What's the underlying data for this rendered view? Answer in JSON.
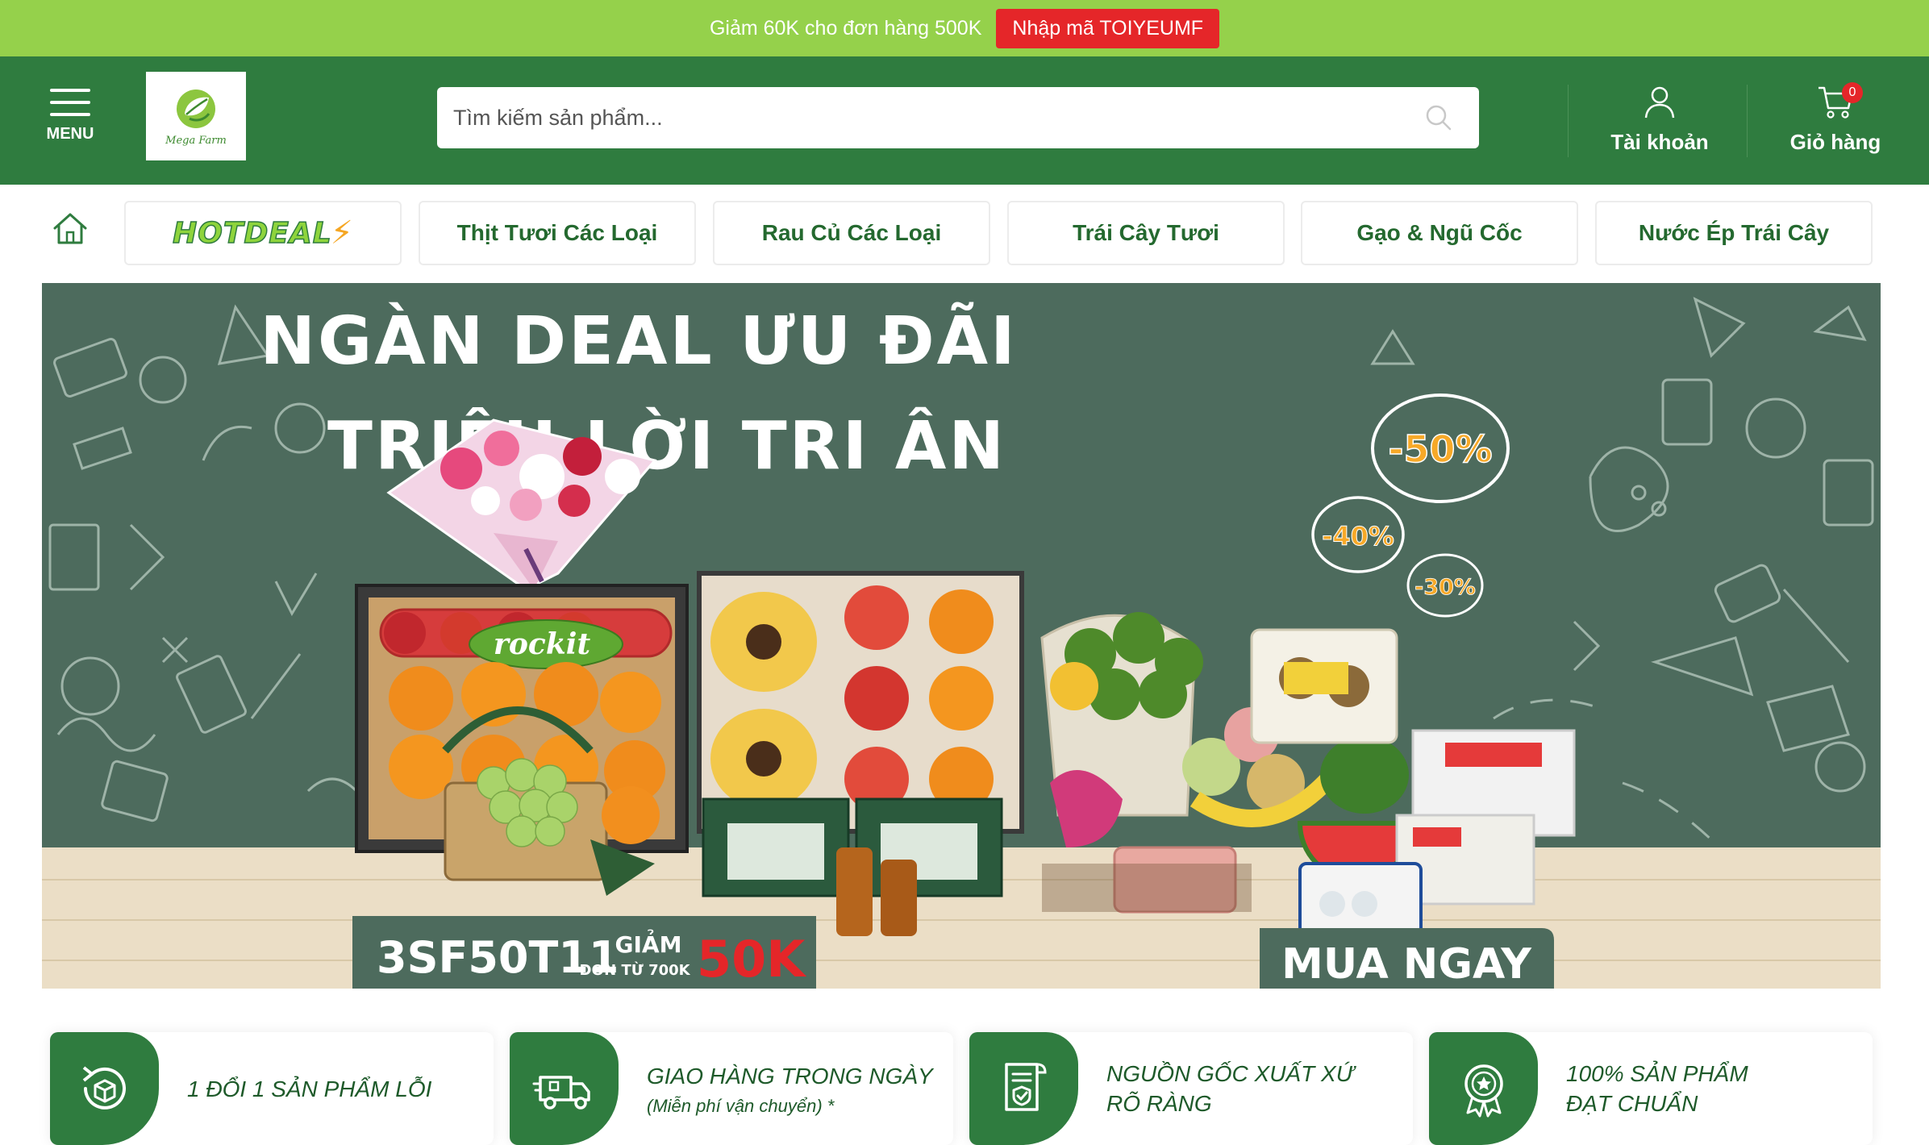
{
  "promo": {
    "text": "Giảm 60K cho đơn hàng 500K",
    "code_button": "Nhập mã TOIYEUMF"
  },
  "header": {
    "menu_label": "MENU",
    "logo_text": "Mega Farm",
    "search_placeholder": "Tìm kiếm sản phẩm...",
    "account_label": "Tài khoản",
    "cart_label": "Giỏ hàng",
    "cart_count": "0"
  },
  "categories": [
    {
      "label": "HOTDEAL",
      "icon": "lightning-bolt-icon"
    },
    {
      "label": "Thịt Tươi Các Loại"
    },
    {
      "label": "Rau Củ Các Loại"
    },
    {
      "label": "Trái Cây Tươi"
    },
    {
      "label": "Gạo & Ngũ Cốc"
    },
    {
      "label": "Nước Ép Trái Cây"
    }
  ],
  "banner": {
    "headline_1": "NGÀN DEAL ƯU ĐÃI",
    "headline_2": "TRIỆU LỜI TRI ÂN",
    "badge_50": "-50%",
    "badge_40": "-40%",
    "badge_30": "-30%",
    "coupon_code": "3SF50T11",
    "coupon_giam": "GIẢM",
    "coupon_condition": "ĐƠN TỪ 700K",
    "coupon_amount": "50K",
    "cta": "MUA NGAY",
    "product_label_rockit": "rockit",
    "colors": {
      "board": "#4d6b5d",
      "floor": "#e9dcc3",
      "accent": "#e52629"
    }
  },
  "features": [
    {
      "title": "1 ĐỔI 1 SẢN PHẨM LỖI",
      "sub": "",
      "icon": "exchange-box-icon"
    },
    {
      "title": "GIAO HÀNG TRONG NGÀY",
      "sub": "(Miễn phí vận chuyển) *",
      "icon": "delivery-truck-icon"
    },
    {
      "title": "NGUỒN GỐC XUẤT XỨ",
      "title_2": "RÕ RÀNG",
      "sub": "",
      "icon": "certificate-scroll-icon"
    },
    {
      "title": "100% SẢN PHẨM",
      "title_2": "ĐẠT CHUẨN",
      "sub": "",
      "icon": "quality-badge-icon"
    }
  ],
  "theme": {
    "green": "#2f7c3f",
    "lime": "#95d14b",
    "red": "#e52629"
  }
}
